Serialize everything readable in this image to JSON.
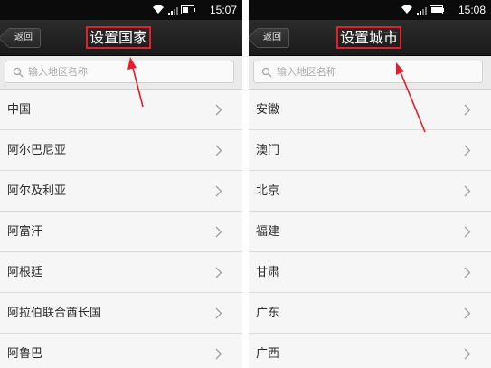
{
  "screens": [
    {
      "status": {
        "time": "15:07"
      },
      "back_label": "返回",
      "title": "设置国家",
      "search_placeholder": "输入地区名称",
      "items": [
        "中国",
        "阿尔巴尼亚",
        "阿尔及利亚",
        "阿富汗",
        "阿根廷",
        "阿拉伯联合酋长国",
        "阿鲁巴"
      ]
    },
    {
      "status": {
        "time": "15:08"
      },
      "back_label": "返回",
      "title": "设置城市",
      "search_placeholder": "输入地区名称",
      "items": [
        "安徽",
        "澳门",
        "北京",
        "福建",
        "甘肃",
        "广东",
        "广西"
      ]
    }
  ],
  "colors": {
    "highlight": "#e0202c",
    "titlebar": "#1f1f1f",
    "list_bg": "#f6f6f6"
  }
}
